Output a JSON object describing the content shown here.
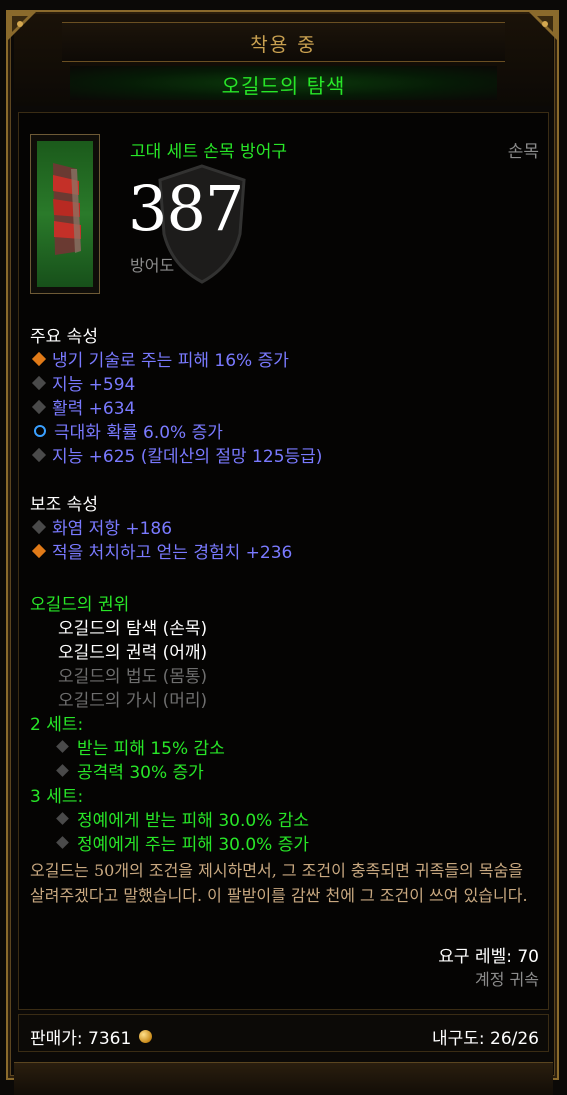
{
  "header": {
    "title": "착용 중",
    "item_name": "오길드의 탐색"
  },
  "item": {
    "type": "고대 세트 손목 방어구",
    "slot": "손목",
    "armor_value": "387",
    "armor_label": "방어도"
  },
  "primary": {
    "heading": "주요 속성",
    "stats": [
      {
        "text": "냉기 기술로 주는 피해 16% 증가",
        "bullet": "orange"
      },
      {
        "text": "지능 +594",
        "bullet": "gray"
      },
      {
        "text": "활력 +634",
        "bullet": "gray"
      },
      {
        "text": "극대화 확률 6.0% 증가",
        "bullet": "blue"
      },
      {
        "text": "지능 +625 (칼데산의 절망 125등급)",
        "bullet": "gray"
      }
    ]
  },
  "secondary": {
    "heading": "보조 속성",
    "stats": [
      {
        "text": "화염 저항 +186",
        "bullet": "gray"
      },
      {
        "text": "적을 처치하고 얻는 경험치 +236",
        "bullet": "orange"
      }
    ]
  },
  "set": {
    "name": "오길드의 권위",
    "pieces": [
      {
        "text": "오길드의 탐색 (손목)",
        "owned": true
      },
      {
        "text": "오길드의 권력 (어깨)",
        "owned": true
      },
      {
        "text": "오길드의 법도 (몸통)",
        "owned": false
      },
      {
        "text": "오길드의 가시 (머리)",
        "owned": false
      }
    ],
    "bonus2_label": "2 세트:",
    "bonus2": [
      "받는 피해 15% 감소",
      "공격력 30% 증가"
    ],
    "bonus3_label": "3 세트:",
    "bonus3": [
      "정예에게 받는 피해 30.0% 감소",
      "정예에게 주는 피해 30.0% 증가"
    ]
  },
  "flavor": "오길드는 50개의 조건을 제시하면서, 그 조건이 충족되면 귀족들의 목숨을 살려주겠다고 말했습니다. 이 팔받이를 감싼 천에 그 조건이 쓰여 있습니다.",
  "requirement": "요구 레벨: 70",
  "bound": "계정 귀속",
  "footer": {
    "sell": "판매가: 7361",
    "durability": "내구도: 26/26"
  },
  "colors": {
    "set_green": "#28e628",
    "magic_blue": "#7a7aff",
    "gold": "#c8a050"
  }
}
